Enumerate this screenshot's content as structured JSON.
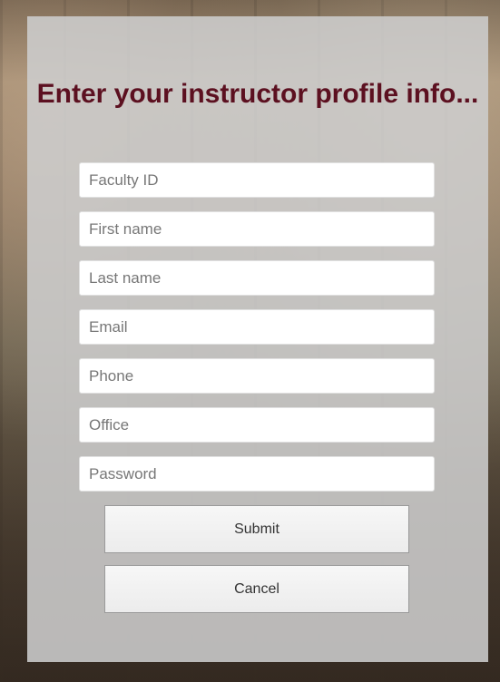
{
  "form": {
    "title": "Enter your instructor profile info...",
    "fields": [
      {
        "name": "faculty-id",
        "placeholder": "Faculty ID",
        "value": ""
      },
      {
        "name": "first-name",
        "placeholder": "First name",
        "value": ""
      },
      {
        "name": "last-name",
        "placeholder": "Last name",
        "value": ""
      },
      {
        "name": "email",
        "placeholder": "Email",
        "value": ""
      },
      {
        "name": "phone",
        "placeholder": "Phone",
        "value": ""
      },
      {
        "name": "office",
        "placeholder": "Office",
        "value": ""
      },
      {
        "name": "password",
        "placeholder": "Password",
        "value": ""
      }
    ],
    "submit_label": "Submit",
    "cancel_label": "Cancel"
  },
  "colors": {
    "title": "#5c1020",
    "panel": "#cdcdcd"
  }
}
